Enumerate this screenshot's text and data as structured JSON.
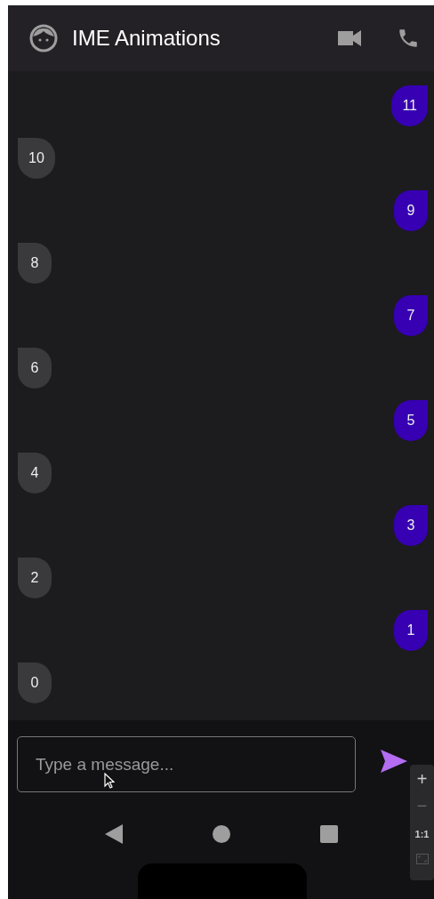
{
  "app_bar": {
    "title": "IME Animations"
  },
  "messages": [
    {
      "text": "11",
      "kind": "outgoing"
    },
    {
      "text": "10",
      "kind": "incoming"
    },
    {
      "text": "9",
      "kind": "outgoing"
    },
    {
      "text": "8",
      "kind": "incoming"
    },
    {
      "text": "7",
      "kind": "outgoing"
    },
    {
      "text": "6",
      "kind": "incoming"
    },
    {
      "text": "5",
      "kind": "outgoing"
    },
    {
      "text": "4",
      "kind": "incoming"
    },
    {
      "text": "3",
      "kind": "outgoing"
    },
    {
      "text": "2",
      "kind": "incoming"
    },
    {
      "text": "1",
      "kind": "outgoing"
    },
    {
      "text": "0",
      "kind": "incoming"
    }
  ],
  "composer": {
    "placeholder": "Type a message..."
  },
  "zoom_controls": {
    "zoom_in": "+",
    "zoom_out": "−",
    "actual_size": "1:1"
  }
}
